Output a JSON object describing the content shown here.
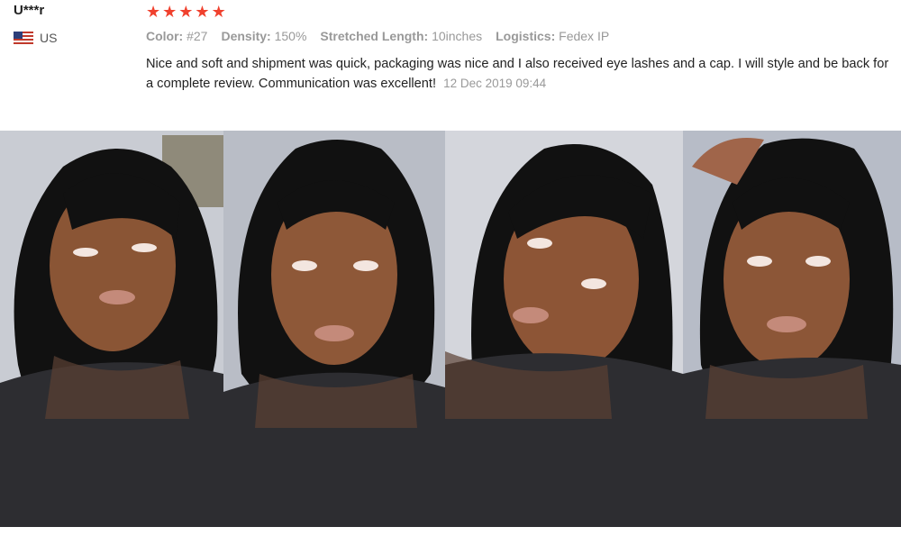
{
  "review": {
    "user_name": "U***r",
    "country": "US",
    "rating_stars": 5,
    "attributes": [
      {
        "label": "Color:",
        "value": "#27"
      },
      {
        "label": "Density:",
        "value": "150%"
      },
      {
        "label": "Stretched Length:",
        "value": "10inches"
      },
      {
        "label": "Logistics:",
        "value": "Fedex IP"
      }
    ],
    "comment": "Nice and soft and shipment was quick, packaging was nice and I also received eye lashes and a cap. I will style and be back for a complete review. Communication was excellent!",
    "date": "12 Dec 2019 09:44"
  },
  "photos": [
    {
      "icon": "review-photo"
    },
    {
      "icon": "review-photo"
    },
    {
      "icon": "review-photo"
    },
    {
      "icon": "review-photo"
    }
  ],
  "colors": {
    "star": "#f0412e",
    "muted": "#999999",
    "text": "#222222",
    "hair": "#111111",
    "skin": "#8a5535",
    "top": "#2d2d31"
  }
}
